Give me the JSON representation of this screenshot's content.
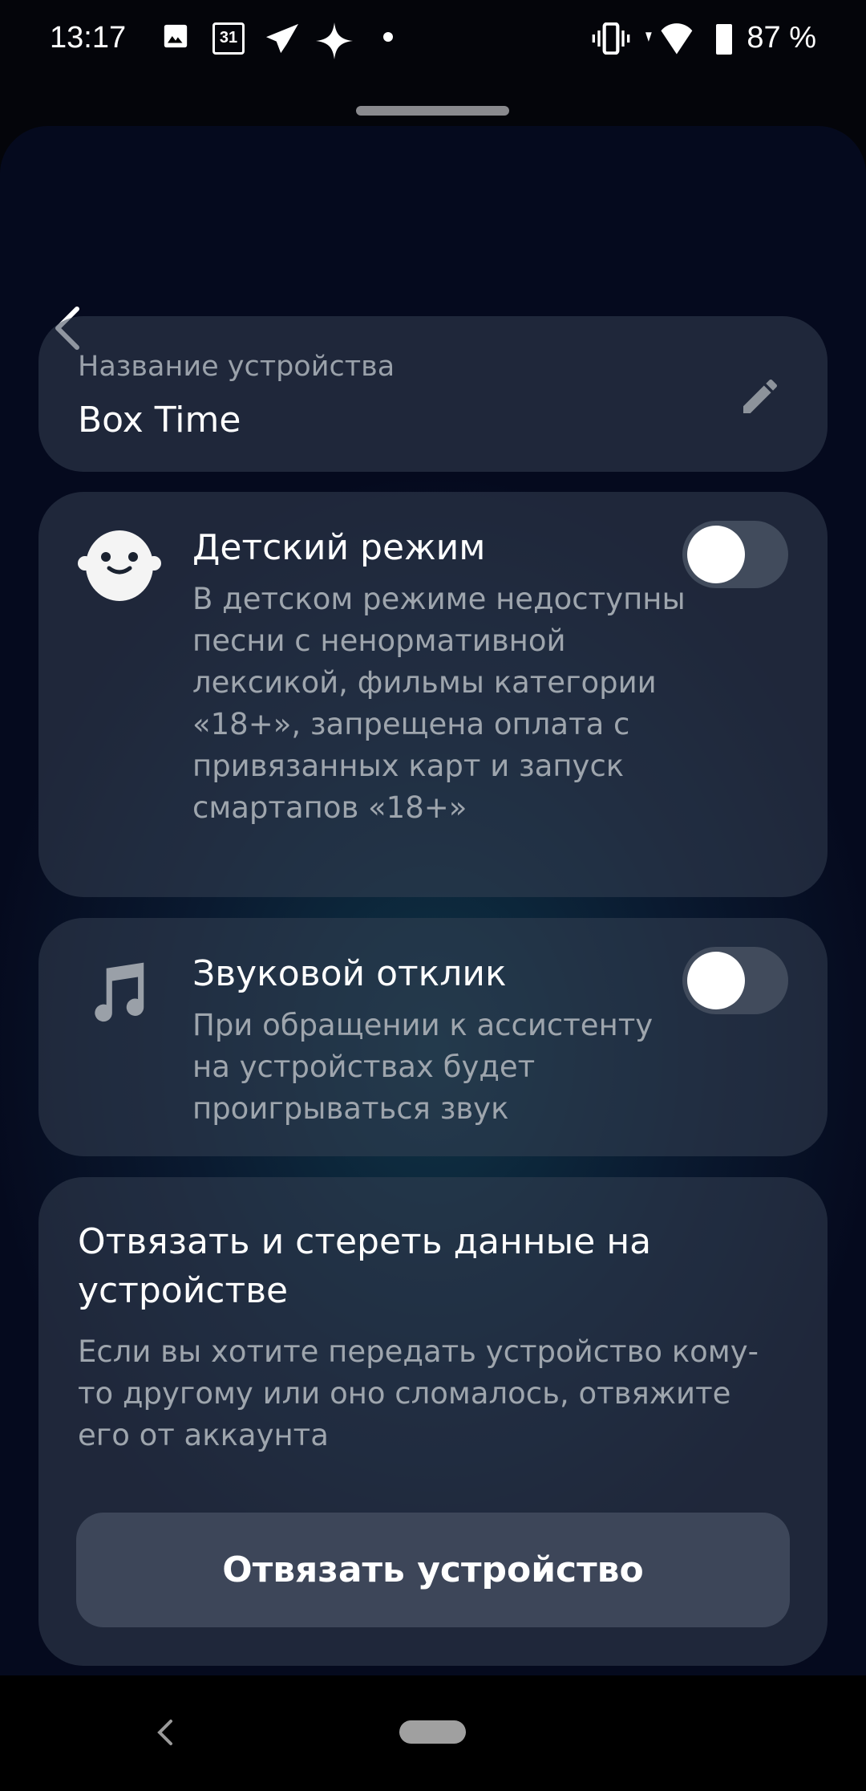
{
  "status_bar": {
    "time": "13:17",
    "calendar_day": "31",
    "battery": "87 %",
    "icons": [
      "image-icon",
      "calendar-icon",
      "telegram-icon",
      "sparkle-icon",
      "dot-icon",
      "vibrate-icon",
      "wifi-icon",
      "battery-icon"
    ]
  },
  "device_name": {
    "label": "Название устройства",
    "value": "Box Time"
  },
  "kids_mode": {
    "title": "Детский режим",
    "description": "В детском режиме недоступны песни с ненормативной лексикой, фильмы категории «18+», запрещена оплата с привязанных карт и запуск смартапов «18+»",
    "enabled": false
  },
  "sound_feedback": {
    "title": "Звуковой отклик",
    "description": "При обращении к ассистенту на устройствах будет проигрываться звук",
    "enabled": false
  },
  "unlink": {
    "title": "Отвязать и стереть данные на устройстве",
    "description": "Если вы хотите передать устройство кому-то другому или оно сломалось, отвяжите его от аккаунта",
    "button_label": "Отвязать устройство"
  }
}
